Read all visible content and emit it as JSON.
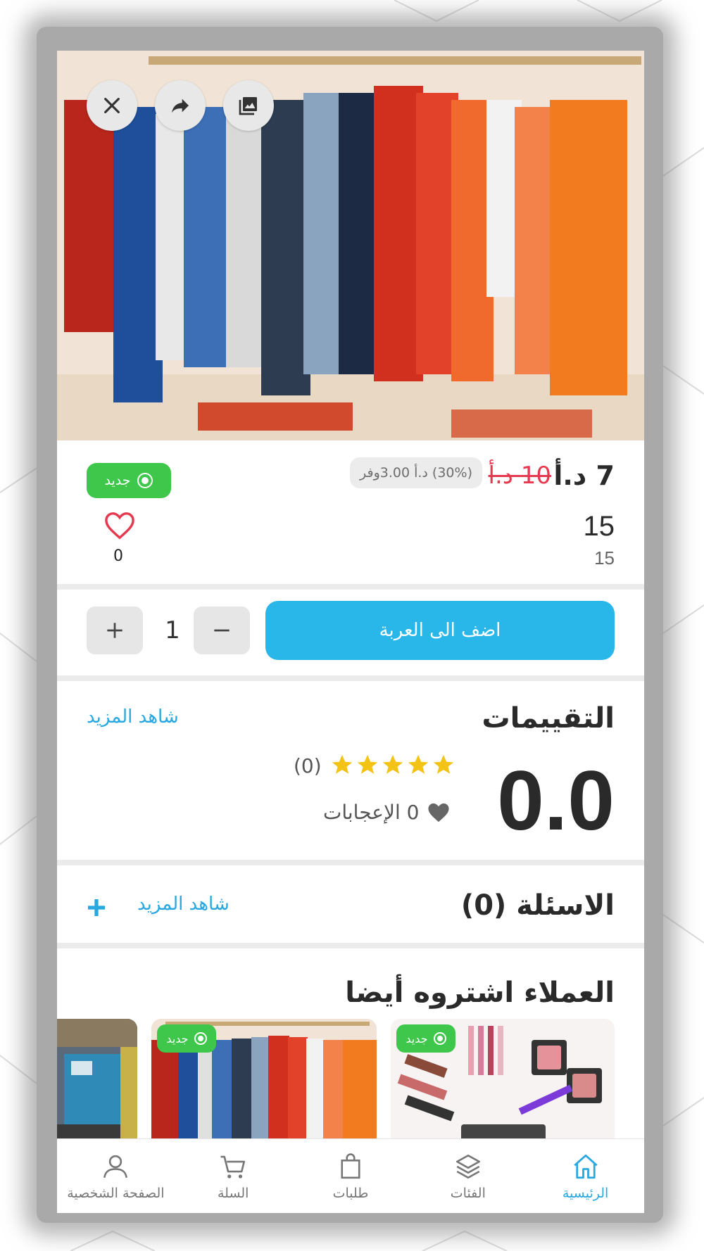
{
  "hero": {
    "buttons": [
      {
        "icon": "close-icon"
      },
      {
        "icon": "share-icon"
      },
      {
        "icon": "gallery-icon"
      }
    ]
  },
  "product": {
    "current_price": "7 د.أ",
    "old_price": "10 د.أ",
    "savings_text": "(30%) د.أ 3.00وفر",
    "badge": "جديد",
    "quantity_title": "15",
    "quantity_subtitle": "15",
    "likes_count": "0"
  },
  "cart": {
    "add_to_cart_label": "اضف الى العربة",
    "quantity": "1"
  },
  "reviews": {
    "title": "التقييمات",
    "see_more": "شاهد المزيد",
    "score": "0.0",
    "stars": 5,
    "count": "(0)",
    "likes": "0 الإعجابات"
  },
  "questions": {
    "title": "الاسئلة (0)",
    "see_more": "شاهد المزيد"
  },
  "also_bought": {
    "title": "العملاء اشتروه أيضا",
    "cards": [
      {
        "badge": "جديد",
        "image": "cosmetics"
      },
      {
        "badge": "جديد",
        "image": "clothes-rack"
      },
      {
        "badge": "",
        "image": "machinery"
      }
    ]
  },
  "bottom_nav": [
    {
      "label": "الرئيسية",
      "icon": "home-icon",
      "active": true
    },
    {
      "label": "الفئات",
      "icon": "layers-icon",
      "active": false
    },
    {
      "label": "طلبات",
      "icon": "bag-icon",
      "active": false
    },
    {
      "label": "السلة",
      "icon": "cart-icon",
      "active": false
    },
    {
      "label": "الصفحة الشخصية",
      "icon": "profile-icon",
      "active": false
    }
  ],
  "colors": {
    "accent": "#29b7ea",
    "new_badge": "#3ec74a",
    "old_price": "#e53950",
    "star": "#f3c316"
  }
}
